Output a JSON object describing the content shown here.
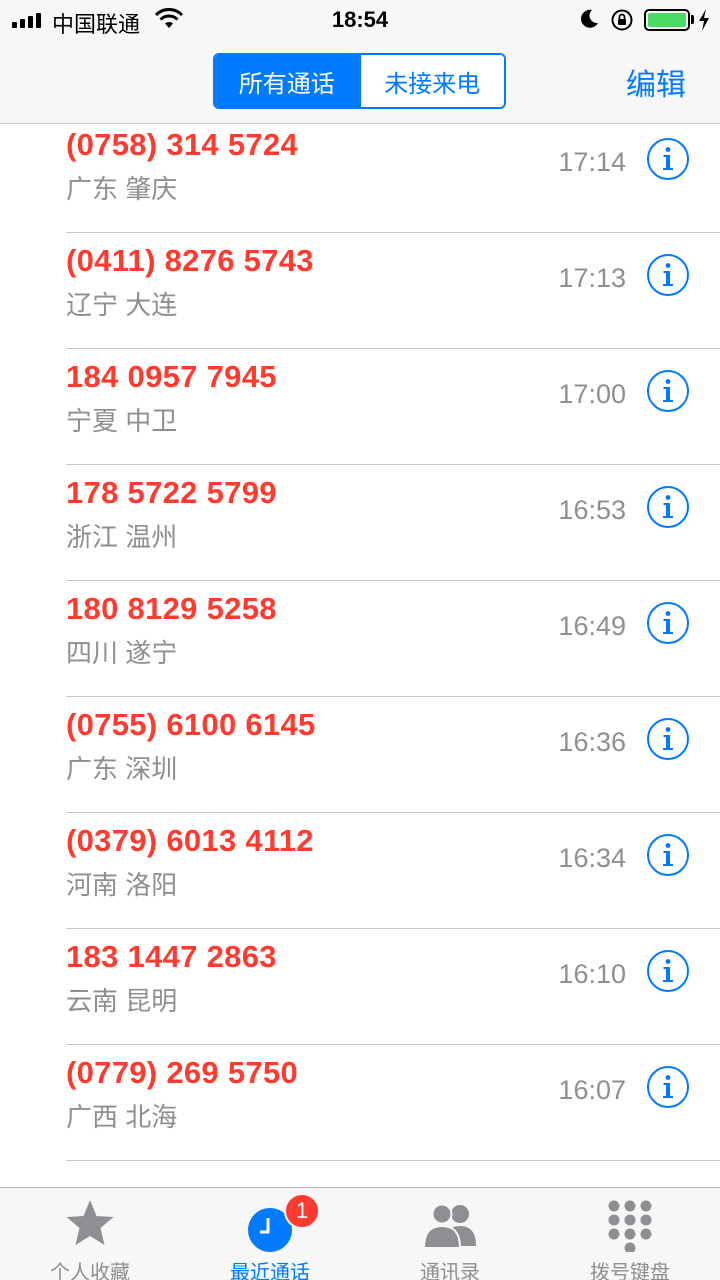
{
  "status_bar": {
    "carrier": "中国联通",
    "time": "18:54"
  },
  "nav": {
    "segments": [
      {
        "label": "所有通话",
        "selected": true
      },
      {
        "label": "未接来电",
        "selected": false
      }
    ],
    "edit_label": "编辑"
  },
  "calls": [
    {
      "number": "(0758) 314 5724",
      "location": "广东 肇庆",
      "time": "17:14"
    },
    {
      "number": "(0411) 8276 5743",
      "location": "辽宁 大连",
      "time": "17:13"
    },
    {
      "number": "184 0957 7945",
      "location": "宁夏 中卫",
      "time": "17:00"
    },
    {
      "number": "178 5722 5799",
      "location": "浙江 温州",
      "time": "16:53"
    },
    {
      "number": "180 8129 5258",
      "location": "四川 遂宁",
      "time": "16:49"
    },
    {
      "number": "(0755) 6100 6145",
      "location": "广东 深圳",
      "time": "16:36"
    },
    {
      "number": "(0379) 6013 4112",
      "location": "河南 洛阳",
      "time": "16:34"
    },
    {
      "number": "183 1447 2863",
      "location": "云南 昆明",
      "time": "16:10"
    },
    {
      "number": "(0779) 269 5750",
      "location": "广西 北海",
      "time": "16:07"
    }
  ],
  "tab_bar": {
    "tabs": [
      {
        "label": "个人收藏",
        "icon": "star-icon",
        "active": false
      },
      {
        "label": "最近通话",
        "icon": "clock-icon",
        "active": true,
        "badge": "1"
      },
      {
        "label": "通讯录",
        "icon": "contacts-icon",
        "active": false
      },
      {
        "label": "拨号键盘",
        "icon": "keypad-icon",
        "active": false
      }
    ]
  },
  "colors": {
    "accent": "#007aff",
    "missed_call": "#ff3b30",
    "secondary_text": "#8e8e93",
    "battery": "#4cd964"
  }
}
